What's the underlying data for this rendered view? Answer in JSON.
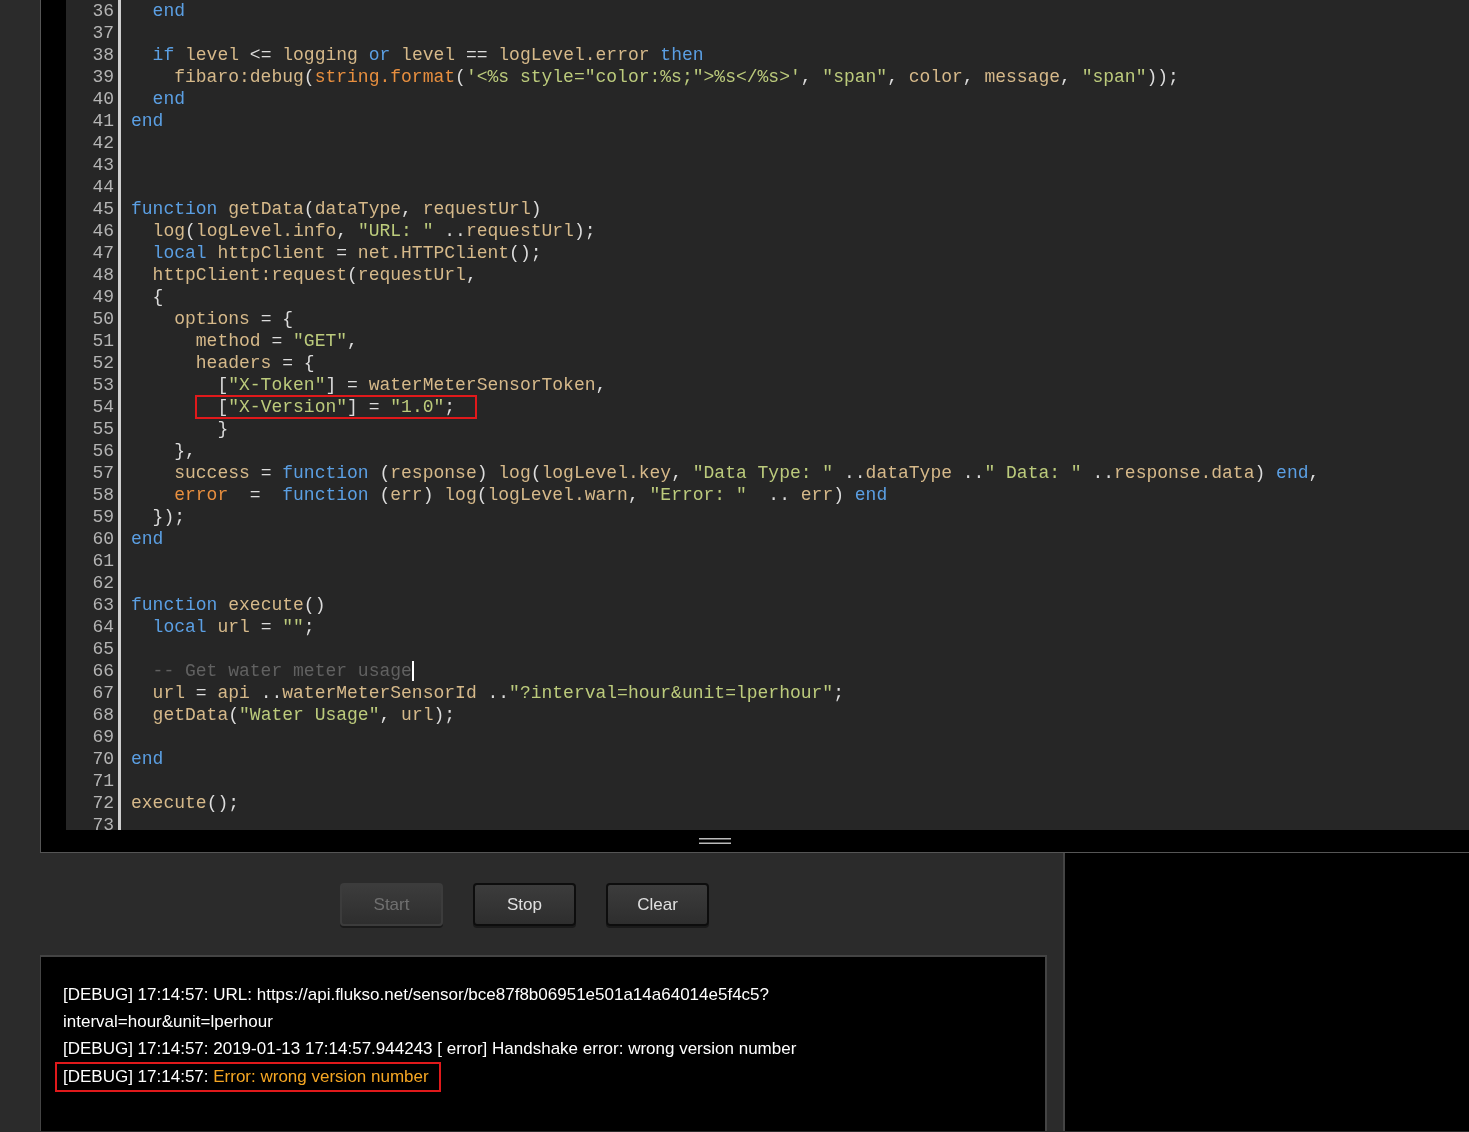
{
  "editor": {
    "lines": [
      {
        "number": "36",
        "highlighted": false,
        "cursor": false,
        "tokens": [
          {
            "kind": "keyword",
            "text": "  end"
          }
        ]
      },
      {
        "number": "37",
        "highlighted": false,
        "cursor": false
      },
      {
        "number": "38",
        "highlighted": false,
        "cursor": false,
        "tokens": [
          {
            "kind": "keyword",
            "text": "  if"
          },
          {
            "kind": "name",
            "text": " level "
          },
          {
            "kind": "punct",
            "text": "<="
          },
          {
            "kind": "name",
            "text": " logging "
          },
          {
            "kind": "keyword",
            "text": "or"
          },
          {
            "kind": "name",
            "text": " level "
          },
          {
            "kind": "punct",
            "text": "=="
          },
          {
            "kind": "name",
            "text": " logLevel.error "
          },
          {
            "kind": "keyword",
            "text": "then"
          }
        ]
      },
      {
        "number": "39",
        "highlighted": false,
        "cursor": false,
        "tokens": [
          {
            "kind": "name",
            "text": "    fibaro:debug"
          },
          {
            "kind": "punct",
            "text": "("
          },
          {
            "kind": "builtin",
            "text": "string.format"
          },
          {
            "kind": "punct",
            "text": "("
          },
          {
            "kind": "string",
            "text": "'<%s style=\"color:%s;\">%s</%s>'"
          },
          {
            "kind": "punct",
            "text": ", "
          },
          {
            "kind": "string",
            "text": "\"span\""
          },
          {
            "kind": "punct",
            "text": ", "
          },
          {
            "kind": "name",
            "text": "color"
          },
          {
            "kind": "punct",
            "text": ", "
          },
          {
            "kind": "name",
            "text": "message"
          },
          {
            "kind": "punct",
            "text": ", "
          },
          {
            "kind": "string",
            "text": "\"span\""
          },
          {
            "kind": "punct",
            "text": "));"
          }
        ]
      },
      {
        "number": "40",
        "highlighted": false,
        "cursor": false,
        "tokens": [
          {
            "kind": "keyword",
            "text": "  end"
          }
        ]
      },
      {
        "number": "41",
        "highlighted": false,
        "cursor": false,
        "tokens": [
          {
            "kind": "keyword",
            "text": "end"
          }
        ]
      },
      {
        "number": "42",
        "highlighted": false,
        "cursor": false
      },
      {
        "number": "43",
        "highlighted": false,
        "cursor": false
      },
      {
        "number": "44",
        "highlighted": false,
        "cursor": false
      },
      {
        "number": "45",
        "highlighted": false,
        "cursor": false,
        "tokens": [
          {
            "kind": "keyword",
            "text": "function"
          },
          {
            "kind": "name",
            "text": " getData"
          },
          {
            "kind": "punct",
            "text": "("
          },
          {
            "kind": "name",
            "text": "dataType"
          },
          {
            "kind": "punct",
            "text": ", "
          },
          {
            "kind": "name",
            "text": "requestUrl"
          },
          {
            "kind": "punct",
            "text": ")"
          }
        ]
      },
      {
        "number": "46",
        "highlighted": false,
        "cursor": false,
        "tokens": [
          {
            "kind": "name",
            "text": "  log"
          },
          {
            "kind": "punct",
            "text": "("
          },
          {
            "kind": "name",
            "text": "logLevel.info"
          },
          {
            "kind": "punct",
            "text": ", "
          },
          {
            "kind": "string",
            "text": "\"URL: \""
          },
          {
            "kind": "punct",
            "text": " .."
          },
          {
            "kind": "name",
            "text": "requestUrl"
          },
          {
            "kind": "punct",
            "text": ");"
          }
        ]
      },
      {
        "number": "47",
        "highlighted": false,
        "cursor": false,
        "tokens": [
          {
            "kind": "keyword",
            "text": "  local"
          },
          {
            "kind": "name",
            "text": " httpClient "
          },
          {
            "kind": "punct",
            "text": "="
          },
          {
            "kind": "name",
            "text": " net.HTTPClient"
          },
          {
            "kind": "punct",
            "text": "();"
          }
        ]
      },
      {
        "number": "48",
        "highlighted": false,
        "cursor": false,
        "tokens": [
          {
            "kind": "name",
            "text": "  httpClient:request"
          },
          {
            "kind": "punct",
            "text": "("
          },
          {
            "kind": "name",
            "text": "requestUrl"
          },
          {
            "kind": "punct",
            "text": ","
          }
        ]
      },
      {
        "number": "49",
        "highlighted": false,
        "cursor": false,
        "tokens": [
          {
            "kind": "punct",
            "text": "  {"
          }
        ]
      },
      {
        "number": "50",
        "highlighted": false,
        "cursor": false,
        "tokens": [
          {
            "kind": "name",
            "text": "    options "
          },
          {
            "kind": "punct",
            "text": "= {"
          }
        ]
      },
      {
        "number": "51",
        "highlighted": false,
        "cursor": false,
        "tokens": [
          {
            "kind": "name",
            "text": "      method "
          },
          {
            "kind": "punct",
            "text": "= "
          },
          {
            "kind": "string",
            "text": "\"GET\""
          },
          {
            "kind": "punct",
            "text": ","
          }
        ]
      },
      {
        "number": "52",
        "highlighted": false,
        "cursor": false,
        "tokens": [
          {
            "kind": "name",
            "text": "      headers "
          },
          {
            "kind": "punct",
            "text": "= {"
          }
        ]
      },
      {
        "number": "53",
        "highlighted": false,
        "cursor": false,
        "tokens": [
          {
            "kind": "punct",
            "text": "        ["
          },
          {
            "kind": "string",
            "text": "\"X-Token\""
          },
          {
            "kind": "punct",
            "text": "] = "
          },
          {
            "kind": "name",
            "text": "waterMeterSensorToken"
          },
          {
            "kind": "punct",
            "text": ","
          }
        ]
      },
      {
        "number": "54",
        "highlighted": true,
        "cursor": false,
        "tokens": [
          {
            "kind": "punct",
            "text": "        ["
          },
          {
            "kind": "string",
            "text": "\"X-Version\""
          },
          {
            "kind": "punct",
            "text": "] = "
          },
          {
            "kind": "string",
            "text": "\"1.0\""
          },
          {
            "kind": "punct",
            "text": ";"
          }
        ]
      },
      {
        "number": "55",
        "highlighted": false,
        "cursor": false,
        "tokens": [
          {
            "kind": "punct",
            "text": "        }"
          }
        ]
      },
      {
        "number": "56",
        "highlighted": false,
        "cursor": false,
        "tokens": [
          {
            "kind": "punct",
            "text": "    },"
          }
        ]
      },
      {
        "number": "57",
        "highlighted": false,
        "cursor": false,
        "tokens": [
          {
            "kind": "name",
            "text": "    success "
          },
          {
            "kind": "punct",
            "text": "= "
          },
          {
            "kind": "keyword",
            "text": "function"
          },
          {
            "kind": "punct",
            "text": " ("
          },
          {
            "kind": "name",
            "text": "response"
          },
          {
            "kind": "punct",
            "text": ") "
          },
          {
            "kind": "name",
            "text": "log"
          },
          {
            "kind": "punct",
            "text": "("
          },
          {
            "kind": "name",
            "text": "logLevel.key"
          },
          {
            "kind": "punct",
            "text": ", "
          },
          {
            "kind": "string",
            "text": "\"Data Type: \""
          },
          {
            "kind": "punct",
            "text": " .."
          },
          {
            "kind": "name",
            "text": "dataType"
          },
          {
            "kind": "punct",
            "text": " .."
          },
          {
            "kind": "string",
            "text": "\" Data: \""
          },
          {
            "kind": "punct",
            "text": " .."
          },
          {
            "kind": "name",
            "text": "response.data"
          },
          {
            "kind": "punct",
            "text": ") "
          },
          {
            "kind": "keyword",
            "text": "end"
          },
          {
            "kind": "punct",
            "text": ","
          }
        ]
      },
      {
        "number": "58",
        "highlighted": false,
        "cursor": false,
        "tokens": [
          {
            "kind": "builtin",
            "text": "    error"
          },
          {
            "kind": "punct",
            "text": "  =  "
          },
          {
            "kind": "keyword",
            "text": "function"
          },
          {
            "kind": "punct",
            "text": " ("
          },
          {
            "kind": "name",
            "text": "err"
          },
          {
            "kind": "punct",
            "text": ") "
          },
          {
            "kind": "name",
            "text": "log"
          },
          {
            "kind": "punct",
            "text": "("
          },
          {
            "kind": "name",
            "text": "logLevel.warn"
          },
          {
            "kind": "punct",
            "text": ", "
          },
          {
            "kind": "string",
            "text": "\"Error: \""
          },
          {
            "kind": "punct",
            "text": "  .. "
          },
          {
            "kind": "name",
            "text": "err"
          },
          {
            "kind": "punct",
            "text": ") "
          },
          {
            "kind": "keyword",
            "text": "end"
          }
        ]
      },
      {
        "number": "59",
        "highlighted": false,
        "cursor": false,
        "tokens": [
          {
            "kind": "punct",
            "text": "  });"
          }
        ]
      },
      {
        "number": "60",
        "highlighted": false,
        "cursor": false,
        "tokens": [
          {
            "kind": "keyword",
            "text": "end"
          }
        ]
      },
      {
        "number": "61",
        "highlighted": false,
        "cursor": false
      },
      {
        "number": "62",
        "highlighted": false,
        "cursor": false
      },
      {
        "number": "63",
        "highlighted": false,
        "cursor": false,
        "tokens": [
          {
            "kind": "keyword",
            "text": "function"
          },
          {
            "kind": "name",
            "text": " execute"
          },
          {
            "kind": "punct",
            "text": "()"
          }
        ]
      },
      {
        "number": "64",
        "highlighted": false,
        "cursor": false,
        "tokens": [
          {
            "kind": "keyword",
            "text": "  local"
          },
          {
            "kind": "name",
            "text": " url "
          },
          {
            "kind": "punct",
            "text": "= "
          },
          {
            "kind": "string",
            "text": "\"\""
          },
          {
            "kind": "punct",
            "text": ";"
          }
        ]
      },
      {
        "number": "65",
        "highlighted": false,
        "cursor": false
      },
      {
        "number": "66",
        "highlighted": false,
        "cursor": true,
        "tokens": [
          {
            "kind": "comment",
            "text": "  -- Get water meter usage"
          }
        ]
      },
      {
        "number": "67",
        "highlighted": false,
        "cursor": false,
        "tokens": [
          {
            "kind": "name",
            "text": "  url "
          },
          {
            "kind": "punct",
            "text": "= "
          },
          {
            "kind": "name",
            "text": "api "
          },
          {
            "kind": "punct",
            "text": ".."
          },
          {
            "kind": "name",
            "text": "waterMeterSensorId "
          },
          {
            "kind": "punct",
            "text": ".."
          },
          {
            "kind": "string",
            "text": "\"?interval=hour&unit=lperhour\""
          },
          {
            "kind": "punct",
            "text": ";"
          }
        ]
      },
      {
        "number": "68",
        "highlighted": false,
        "cursor": false,
        "tokens": [
          {
            "kind": "name",
            "text": "  getData"
          },
          {
            "kind": "punct",
            "text": "("
          },
          {
            "kind": "string",
            "text": "\"Water Usage\""
          },
          {
            "kind": "punct",
            "text": ", "
          },
          {
            "kind": "name",
            "text": "url"
          },
          {
            "kind": "punct",
            "text": ");"
          }
        ]
      },
      {
        "number": "69",
        "highlighted": false,
        "cursor": false
      },
      {
        "number": "70",
        "highlighted": false,
        "cursor": false,
        "tokens": [
          {
            "kind": "keyword",
            "text": "end"
          }
        ]
      },
      {
        "number": "71",
        "highlighted": false,
        "cursor": false
      },
      {
        "number": "72",
        "highlighted": false,
        "cursor": false,
        "tokens": [
          {
            "kind": "name",
            "text": "execute"
          },
          {
            "kind": "punct",
            "text": "();"
          }
        ]
      },
      {
        "number": "73",
        "highlighted": false,
        "cursor": false
      }
    ]
  },
  "buttons": [
    {
      "label": "Start",
      "disabled": true
    },
    {
      "label": "Stop",
      "disabled": false
    },
    {
      "label": "Clear",
      "disabled": false
    }
  ],
  "log": [
    {
      "prefix": "[DEBUG] 17:14:57:",
      "message": "URL: https://api.flukso.net/sensor/bce87f8b06951e501a14a64014e5f4c5?interval=hour&unit=lperhour",
      "color": "#ffffff",
      "highlighted": false
    },
    {
      "prefix": "[DEBUG] 17:14:57:",
      "message": "2019-01-13 17:14:57.944243 [ error] Handshake error: wrong version number",
      "color": "#ffffff",
      "highlighted": false
    },
    {
      "prefix": "[DEBUG] 17:14:57:",
      "message": "Error: wrong version number",
      "color": "#f5a623",
      "highlighted": true
    }
  ]
}
